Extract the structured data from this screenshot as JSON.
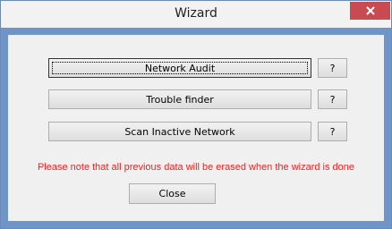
{
  "window": {
    "title": "Wizard",
    "close_icon": "close-icon"
  },
  "buttons": {
    "network_audit": "Network Audit",
    "trouble_finder": "Trouble finder",
    "scan_inactive": "Scan Inactive Network",
    "help": "?",
    "close": "Close"
  },
  "message": "Please note that all previous data will be erased when the wizard is done",
  "colors": {
    "title_bar": "#f2f2f2",
    "close_button": "#c74b50",
    "frame": "#6f95c8",
    "warning_text": "#ff1a1a"
  }
}
